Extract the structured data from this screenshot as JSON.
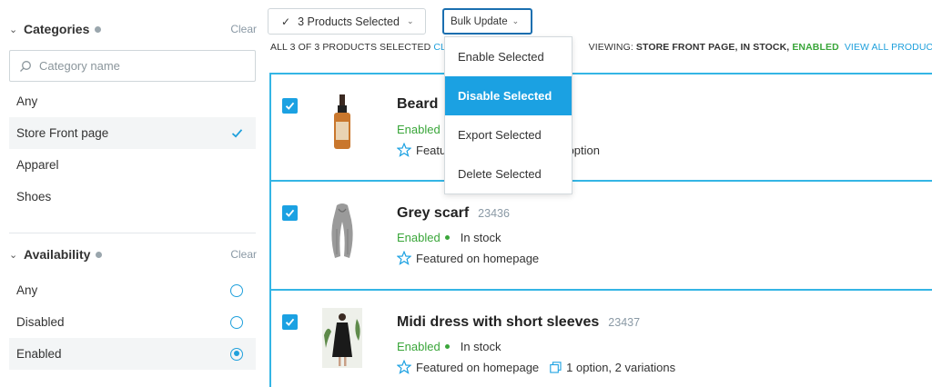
{
  "sidebar": {
    "categories": {
      "title": "Categories",
      "clear": "Clear",
      "search_placeholder": "Category name",
      "items": [
        {
          "label": "Any"
        },
        {
          "label": "Store Front page",
          "selected": true
        },
        {
          "label": "Apparel"
        },
        {
          "label": "Shoes"
        }
      ]
    },
    "availability": {
      "title": "Availability",
      "clear": "Clear",
      "items": [
        {
          "label": "Any"
        },
        {
          "label": "Disabled"
        },
        {
          "label": "Enabled",
          "selected": true
        }
      ]
    }
  },
  "toolbar": {
    "products_selected": "3 Products Selected",
    "bulk_update": "Bulk Update"
  },
  "status": {
    "selected_text": "ALL 3 OF 3 PRODUCTS SELECTED",
    "clear_link": "CLEA",
    "viewing_label": "VIEWING:",
    "viewing_value": "STORE FRONT PAGE, IN STOCK,",
    "enabled": "ENABLED",
    "view_all": "VIEW ALL PRODUCTS"
  },
  "bulk_menu": {
    "items": [
      {
        "label": "Enable Selected"
      },
      {
        "label": "Disable Selected",
        "active": true
      },
      {
        "label": "Export Selected"
      },
      {
        "label": "Delete Selected"
      }
    ]
  },
  "products": [
    {
      "name": "Beard",
      "sku": "",
      "status": "Enabled",
      "stock": "",
      "featured": "Featur",
      "options": "option"
    },
    {
      "name": "Grey scarf",
      "sku": "23436",
      "status": "Enabled",
      "stock": "In stock",
      "featured": "Featured on homepage",
      "options": ""
    },
    {
      "name": "Midi dress with short sleeves",
      "sku": "23437",
      "status": "Enabled",
      "stock": "In stock",
      "featured": "Featured on homepage",
      "options": "1 option, 2 variations"
    }
  ],
  "colors": {
    "accent": "#1ba1e2",
    "enabled_green": "#3aa63a",
    "row_border": "#34b5e5"
  }
}
